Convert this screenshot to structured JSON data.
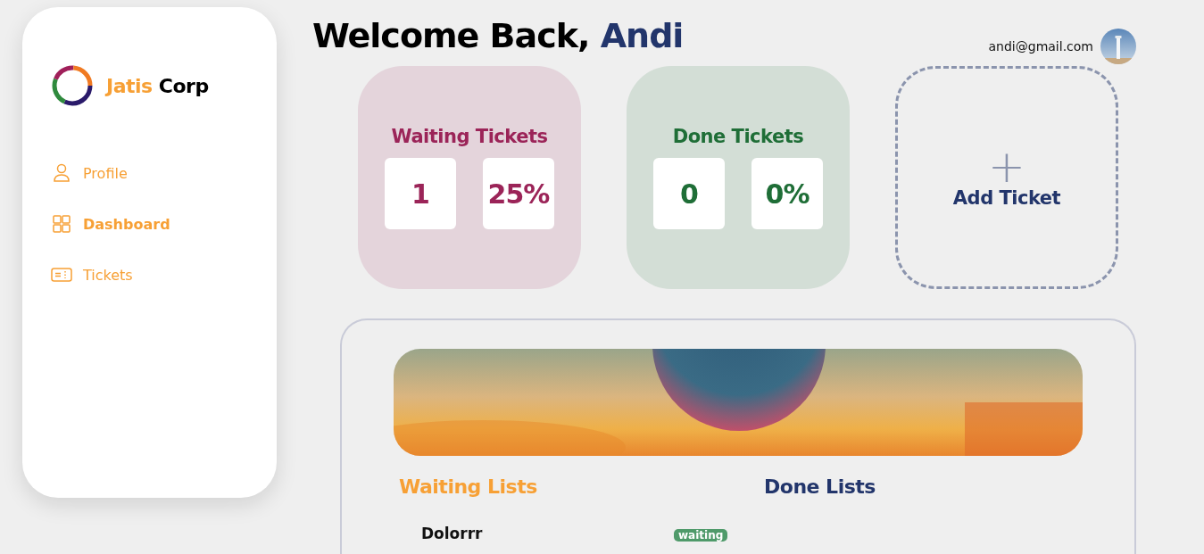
{
  "sidebar": {
    "brand": {
      "first": "Jatis",
      "second": "Corp"
    },
    "items": [
      {
        "label": "Profile",
        "kind": "profile",
        "selected": false
      },
      {
        "label": "Dashboard",
        "kind": "dashboard",
        "selected": true
      },
      {
        "label": "Tickets",
        "kind": "tickets",
        "selected": false
      }
    ]
  },
  "header": {
    "greeting": "Welcome Back,",
    "name": "Andi",
    "email": "andi@gmail.com"
  },
  "stats": [
    {
      "title": "Waiting Tickets",
      "count": "1",
      "percent": "25%",
      "color": "#9b2458"
    },
    {
      "title": "Done Tickets",
      "count": "0",
      "percent": "0%",
      "color": "#1f6e37"
    }
  ],
  "add_ticket": {
    "icon": "+",
    "label": "Add Ticket"
  },
  "lists": {
    "waiting_title": "Waiting Lists",
    "done_title": "Done Lists",
    "rows": [
      {
        "title": "Dolorrr",
        "status": "waiting"
      }
    ]
  }
}
